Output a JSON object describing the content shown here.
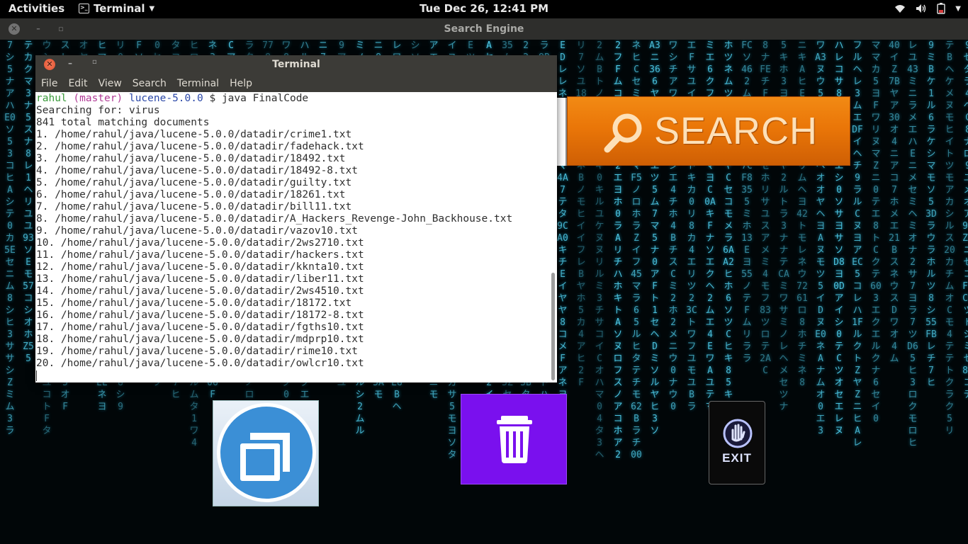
{
  "topbar": {
    "activities": "Activities",
    "app_name": "Terminal",
    "clock": "Tue Dec 26, 12:41 PM",
    "icons": [
      "wifi-icon",
      "volume-icon",
      "battery-icon",
      "chevron-down-icon"
    ]
  },
  "app_window": {
    "title": "Search Engine"
  },
  "terminal": {
    "title": "Terminal",
    "menu": [
      "File",
      "Edit",
      "View",
      "Search",
      "Terminal",
      "Help"
    ],
    "prompt": {
      "user": "rahul",
      "branch": "(master)",
      "dir": "lucene-5.0.0",
      "symbol": "$",
      "command": "java FinalCode"
    },
    "output": [
      "Searching for: virus",
      "841 total matching documents",
      "1. /home/rahul/java/lucene-5.0.0/datadir/crime1.txt",
      "2. /home/rahul/java/lucene-5.0.0/datadir/fadehack.txt",
      "3. /home/rahul/java/lucene-5.0.0/datadir/18492.txt",
      "4. /home/rahul/java/lucene-5.0.0/datadir/18492-8.txt",
      "5. /home/rahul/java/lucene-5.0.0/datadir/guilty.txt",
      "6. /home/rahul/java/lucene-5.0.0/datadir/18261.txt",
      "7. /home/rahul/java/lucene-5.0.0/datadir/bill11.txt",
      "8. /home/rahul/java/lucene-5.0.0/datadir/A_Hackers_Revenge-John_Backhouse.txt",
      "9. /home/rahul/java/lucene-5.0.0/datadir/vazov10.txt",
      "10. /home/rahul/java/lucene-5.0.0/datadir/2ws2710.txt",
      "11. /home/rahul/java/lucene-5.0.0/datadir/hackers.txt",
      "12. /home/rahul/java/lucene-5.0.0/datadir/kknta10.txt",
      "13. /home/rahul/java/lucene-5.0.0/datadir/liber11.txt",
      "14. /home/rahul/java/lucene-5.0.0/datadir/2ws4510.txt",
      "15. /home/rahul/java/lucene-5.0.0/datadir/18172.txt",
      "16. /home/rahul/java/lucene-5.0.0/datadir/18172-8.txt",
      "17. /home/rahul/java/lucene-5.0.0/datadir/fgths10.txt",
      "18. /home/rahul/java/lucene-5.0.0/datadir/mdprp10.txt",
      "19. /home/rahul/java/lucene-5.0.0/datadir/rime10.txt",
      "20. /home/rahul/java/lucene-5.0.0/datadir/owlcr10.txt"
    ]
  },
  "buttons": {
    "search_label": "SEARCH",
    "search_icon": "magnifier-icon",
    "window_icon": "window-restore-icon",
    "delete_icon": "trash-icon",
    "exit_label": "EXIT",
    "exit_icon": "hand-stop-icon"
  },
  "colors": {
    "search_orange": "#ea7608",
    "delete_purple": "#7a10ee",
    "matrix_cyan": "#4fc9e6",
    "prompt_user": "#3a9a3a",
    "prompt_branch": "#b03a95",
    "prompt_dir": "#2b48a8"
  }
}
